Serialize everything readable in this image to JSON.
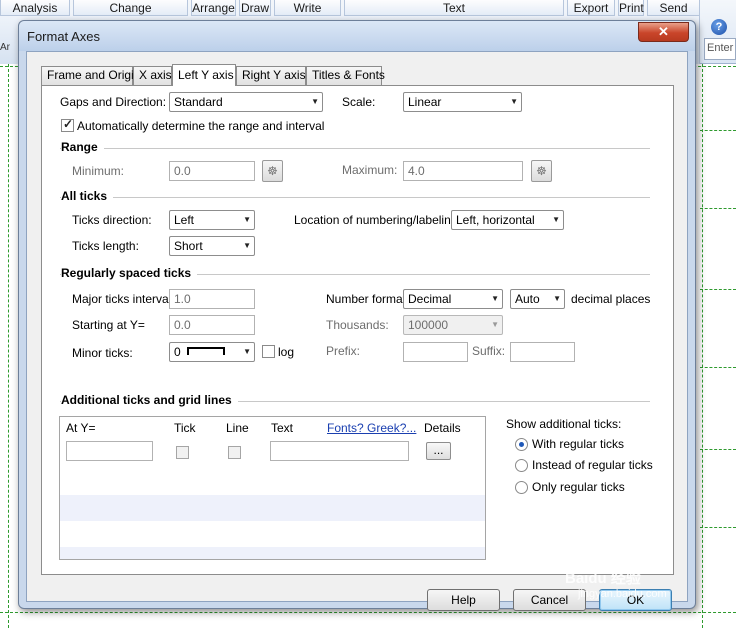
{
  "app": {
    "ribbon_tabs": [
      "Analysis",
      "Change",
      "Arrange",
      "Draw",
      "Write",
      "Text",
      "Export",
      "Print",
      "Send"
    ],
    "left_strip_text": "Ar",
    "help_icon": "help-circle-icon",
    "search_placeholder": "Enter"
  },
  "dialog": {
    "title": "Format Axes",
    "close_glyph": "✕",
    "tabs": [
      "Frame and Origin",
      "X axis",
      "Left Y axis",
      "Right Y axis",
      "Titles & Fonts"
    ],
    "active_tab": "Left Y axis",
    "gaps_label": "Gaps and Direction:",
    "gaps_value": "Standard",
    "scale_label": "Scale:",
    "scale_value": "Linear",
    "auto_range_label": "Automatically determine the range and interval",
    "auto_range_checked": true,
    "range": {
      "heading": "Range",
      "min_label": "Minimum:",
      "min_value": "0.0",
      "max_label": "Maximum:",
      "max_value": "4.0",
      "lock_icon": "lock-icon"
    },
    "all_ticks": {
      "heading": "All ticks",
      "direction_label": "Ticks direction:",
      "direction_value": "Left",
      "location_label": "Location of numbering/labeling:",
      "location_value": "Left, horizontal",
      "length_label": "Ticks length:",
      "length_value": "Short"
    },
    "regular": {
      "heading": "Regularly spaced ticks",
      "major_label": "Major ticks interval:",
      "major_value": "1.0",
      "start_label": "Starting at Y=",
      "start_value": "0.0",
      "minor_label": "Minor ticks:",
      "minor_value": "0",
      "log_label": "log",
      "numfmt_label": "Number format:",
      "numfmt_value": "Decimal",
      "decimals_value": "Auto",
      "decimals_label": "decimal places",
      "thousands_label": "Thousands:",
      "thousands_value": "100000",
      "prefix_label": "Prefix:",
      "suffix_label": "Suffix:"
    },
    "additional": {
      "heading": "Additional ticks and grid lines",
      "columns": [
        "At Y=",
        "Tick",
        "Line",
        "Text",
        "Fonts? Greek?...",
        "Details"
      ],
      "details_button": "...",
      "show_label": "Show additional ticks:",
      "options": [
        "With regular ticks",
        "Instead of regular ticks",
        "Only regular ticks"
      ],
      "selected_option": 0
    },
    "buttons": {
      "help": "Help",
      "cancel": "Cancel",
      "ok": "OK"
    }
  },
  "watermark": {
    "text_top": "Baidu 经验",
    "text_bottom": "jingyan.baidu.com"
  },
  "colors": {
    "grid_dash": "#2e9a2e",
    "dialog_frame": "#c9d8ec",
    "close_button": "#c9452a",
    "link": "#1a3fb0"
  }
}
